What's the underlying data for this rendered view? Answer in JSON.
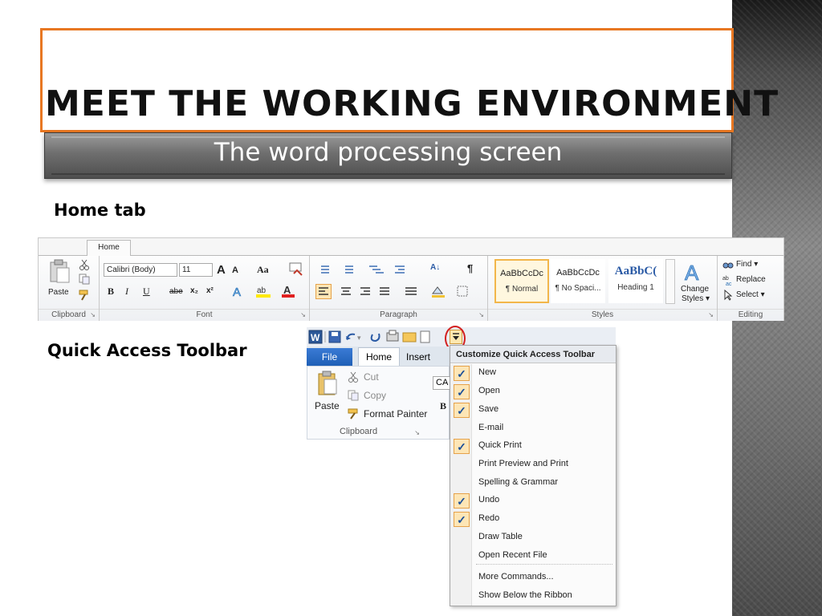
{
  "slide": {
    "title": "MEET THE WORKING ENVIRONMENT",
    "subtitle": "The word processing screen",
    "label_home_tab": "Home tab",
    "label_qat": "Quick Access Toolbar",
    "colors": {
      "title_border": "#e87722",
      "subtitle_bar": "#5a5a5a",
      "highlight_circle": "#d31f1f"
    }
  },
  "ribbon": {
    "tab": "Home",
    "clipboard": {
      "paste": "Paste",
      "group": "Clipboard"
    },
    "font": {
      "name": "Calibri (Body)",
      "size": "11",
      "case_btn": "Aa",
      "grow": "A",
      "shrink": "A",
      "bold": "B",
      "italic": "I",
      "underline": "U",
      "strike": "abe",
      "sub": "x₂",
      "sup": "x²",
      "group": "Font"
    },
    "paragraph": {
      "group": "Paragraph",
      "pilcrow": "¶",
      "sort": "A↓"
    },
    "styles": {
      "group": "Styles",
      "items": [
        {
          "sample": "AaBbCcDc",
          "name": "¶ Normal"
        },
        {
          "sample": "AaBbCcDc",
          "name": "¶ No Spaci..."
        },
        {
          "sample": "AaBbC(",
          "name": "Heading 1"
        }
      ],
      "change": "Change",
      "change2": "Styles ▾"
    },
    "editing": {
      "group": "Editing",
      "find": "Find ▾",
      "replace": "Replace",
      "select": "Select ▾"
    }
  },
  "qat_shot": {
    "tabs": {
      "file": "File",
      "home": "Home",
      "insert": "Insert"
    },
    "clipboard": {
      "paste": "Paste",
      "cut": "Cut",
      "copy": "Copy",
      "format_painter": "Format Painter",
      "group": "Clipboard",
      "font_peek": "CA",
      "bold_peek": "B"
    },
    "menu": {
      "header": "Customize Quick Access Toolbar",
      "items": [
        {
          "label": "New",
          "checked": true
        },
        {
          "label": "Open",
          "checked": true
        },
        {
          "label": "Save",
          "checked": true
        },
        {
          "label": "E-mail",
          "checked": false
        },
        {
          "label": "Quick Print",
          "checked": true
        },
        {
          "label": "Print Preview and Print",
          "checked": false
        },
        {
          "label": "Spelling & Grammar",
          "checked": false
        },
        {
          "label": "Undo",
          "checked": true
        },
        {
          "label": "Redo",
          "checked": true
        },
        {
          "label": "Draw Table",
          "checked": false
        },
        {
          "label": "Open Recent File",
          "checked": false
        },
        {
          "label": "More Commands...",
          "checked": false
        },
        {
          "label": "Show Below the Ribbon",
          "checked": false
        }
      ],
      "check_glyph": "✓"
    }
  }
}
